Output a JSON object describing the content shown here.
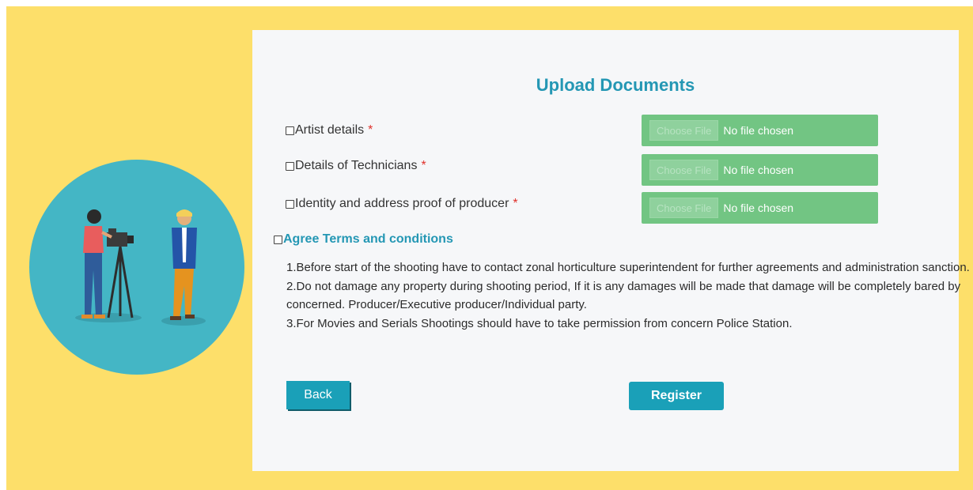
{
  "form": {
    "title": "Upload Documents",
    "documents": [
      {
        "label": "Artist details",
        "required_mark": "*",
        "file_button": "Choose File",
        "file_status": "No file chosen"
      },
      {
        "label": "Details of Technicians",
        "required_mark": "*",
        "file_button": "Choose File",
        "file_status": "No file chosen"
      },
      {
        "label": "Identity and address proof of producer",
        "required_mark": "*",
        "file_button": "Choose File",
        "file_status": "No file chosen"
      }
    ],
    "agree_label": "Agree Terms and conditions",
    "terms": [
      "1.Before start of the shooting have to contact zonal horticulture superintendent for further agreements and administration sanction.",
      "2.Do not damage any property during shooting period, If it is any damages will be made that damage will be completely bared by concerned. Producer/Executive producer/Individual party.",
      "3.For Movies and Serials Shootings should have to take permission from concern Police Station."
    ],
    "back_label": "Back",
    "register_label": "Register"
  },
  "colors": {
    "page_background": "#fddf6a",
    "accent": "#2497b4",
    "button": "#1aa0b8",
    "file_input": "#72c583",
    "required": "#e0312b"
  }
}
